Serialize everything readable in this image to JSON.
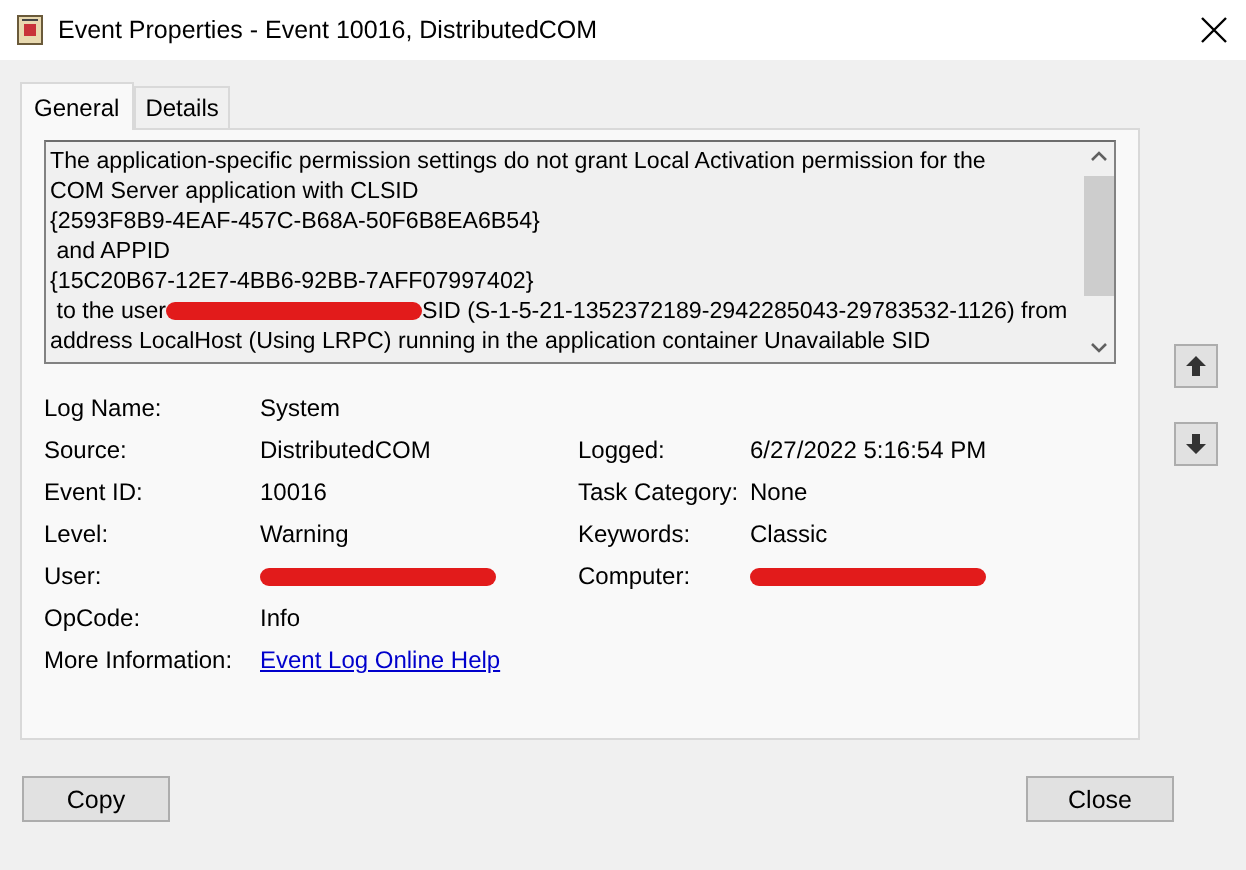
{
  "window": {
    "title": "Event Properties - Event 10016, DistributedCOM"
  },
  "tabs": [
    {
      "label": "General",
      "selected": true
    },
    {
      "label": "Details",
      "selected": false
    }
  ],
  "description": {
    "lines": [
      {
        "kind": "text",
        "text": "The application-specific permission settings do not grant Local Activation permission for the"
      },
      {
        "kind": "text",
        "text": "COM Server application with CLSID"
      },
      {
        "kind": "text",
        "text": "{2593F8B9-4EAF-457C-B68A-50F6B8EA6B54}"
      },
      {
        "kind": "text",
        "text": " and APPID"
      },
      {
        "kind": "text",
        "text": "{15C20B67-12E7-4BB6-92BB-7AFF07997402}"
      },
      {
        "kind": "redacted",
        "before": " to the user",
        "after": "SID (S-1-5-21-1352372189-2942285043-29783532-1126) from"
      },
      {
        "kind": "text",
        "text": "address LocalHost (Using LRPC) running in the application container Unavailable SID"
      }
    ]
  },
  "fields": [
    {
      "label": "Log Name:",
      "kind": "text",
      "value": "System"
    },
    {
      "label": "Source:",
      "kind": "text",
      "value": "DistributedCOM",
      "right": {
        "label": "Logged:",
        "kind": "text",
        "value": "6/27/2022 5:16:54 PM"
      }
    },
    {
      "label": "Event ID:",
      "kind": "text",
      "value": "10016",
      "right": {
        "label": "Task Category:",
        "kind": "text",
        "value": "None"
      }
    },
    {
      "label": "Level:",
      "kind": "text",
      "value": "Warning",
      "right": {
        "label": "Keywords:",
        "kind": "text",
        "value": "Classic"
      }
    },
    {
      "label": "User:",
      "kind": "redacted",
      "right": {
        "label": "Computer:",
        "kind": "redacted"
      }
    },
    {
      "label": "OpCode:",
      "kind": "text",
      "value": "Info"
    },
    {
      "label": "More Information:",
      "kind": "link",
      "value": "Event Log Online Help"
    }
  ],
  "buttons": {
    "copy": "Copy",
    "close": "Close"
  }
}
